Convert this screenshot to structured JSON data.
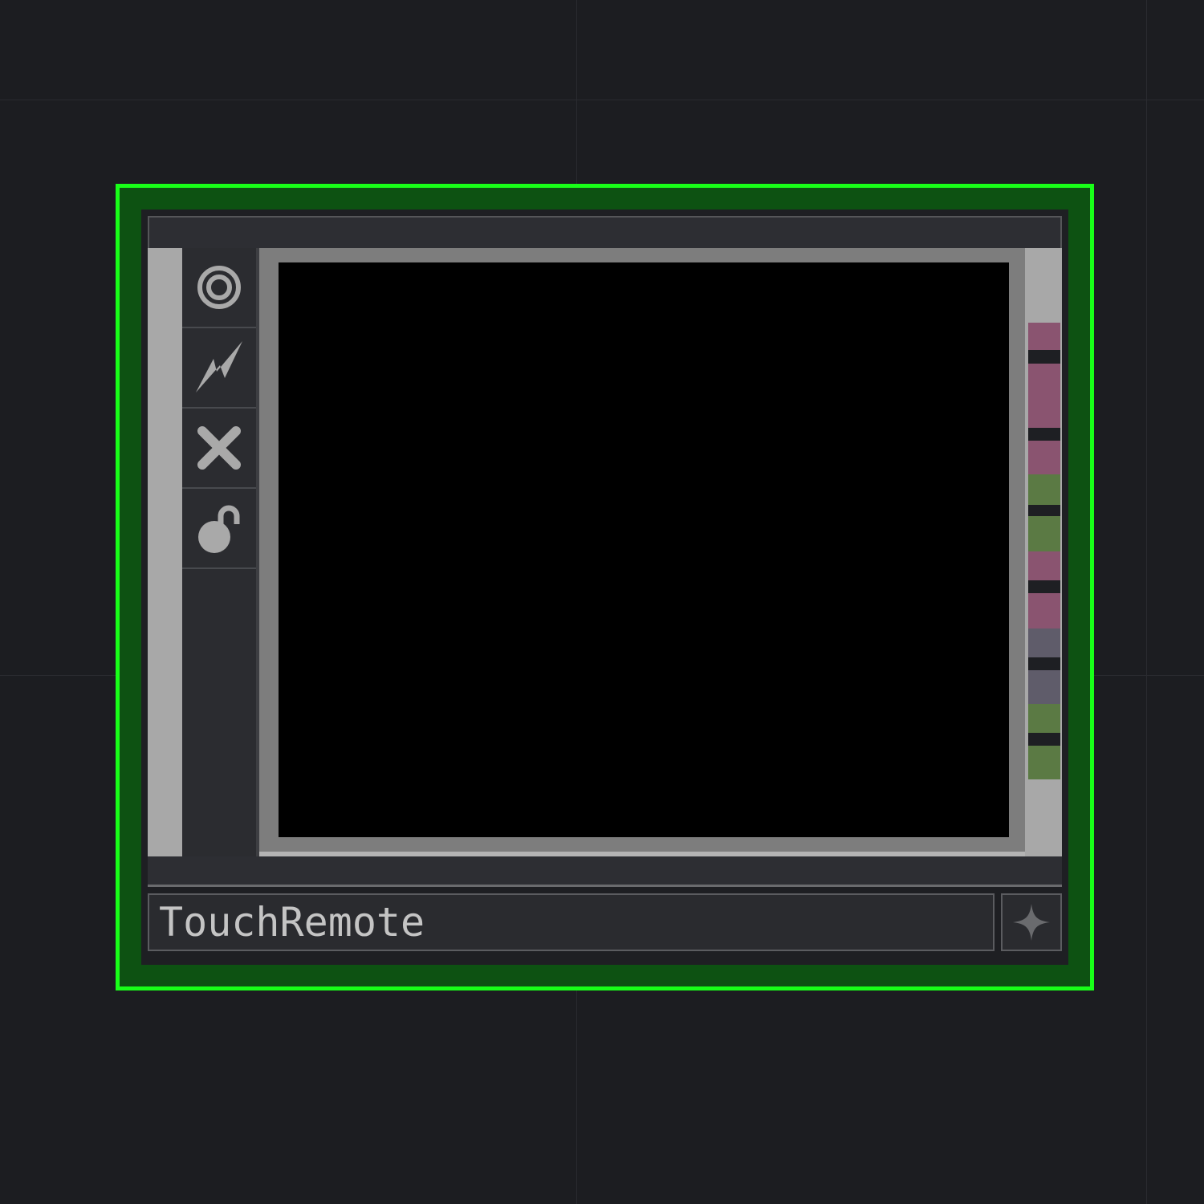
{
  "node": {
    "name": "TouchRemote",
    "selected": true,
    "border_color": "#18ff18",
    "fill_color": "#0d5212"
  },
  "toolbar": {
    "buttons": [
      {
        "icon": "target-icon"
      },
      {
        "icon": "lightning-icon"
      },
      {
        "icon": "close-icon"
      },
      {
        "icon": "unlock-icon"
      }
    ]
  },
  "viewer": {
    "background": "#000000"
  },
  "connectors": {
    "colors": {
      "pink": "#8a5470",
      "green": "#5b7a44",
      "gray": "#5f5c6a"
    }
  },
  "corner_button": {
    "icon": "sparkle-icon"
  }
}
